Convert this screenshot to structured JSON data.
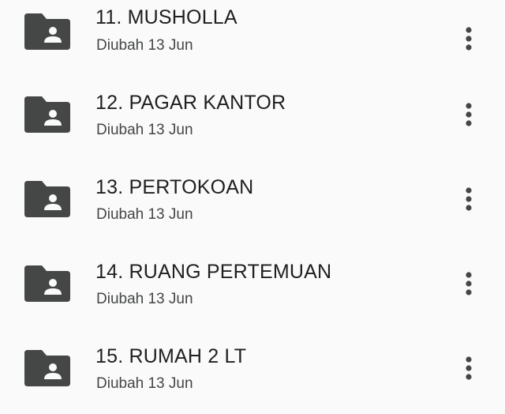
{
  "files": [
    {
      "name": "11. MUSHOLLA",
      "modified": "Diubah 13 Jun",
      "icon": "shared-folder-icon"
    },
    {
      "name": "12. PAGAR KANTOR",
      "modified": "Diubah 13 Jun",
      "icon": "shared-folder-icon"
    },
    {
      "name": "13. PERTOKOAN",
      "modified": "Diubah 13 Jun",
      "icon": "shared-folder-icon"
    },
    {
      "name": "14. RUANG PERTEMUAN",
      "modified": "Diubah 13 Jun",
      "icon": "shared-folder-icon"
    },
    {
      "name": "15. RUMAH 2 LT",
      "modified": "Diubah 13 Jun",
      "icon": "shared-folder-icon"
    }
  ],
  "colors": {
    "background": "#fafafa",
    "icon": "#444746",
    "title_text": "#1f1f1f",
    "meta_text": "#444746"
  }
}
